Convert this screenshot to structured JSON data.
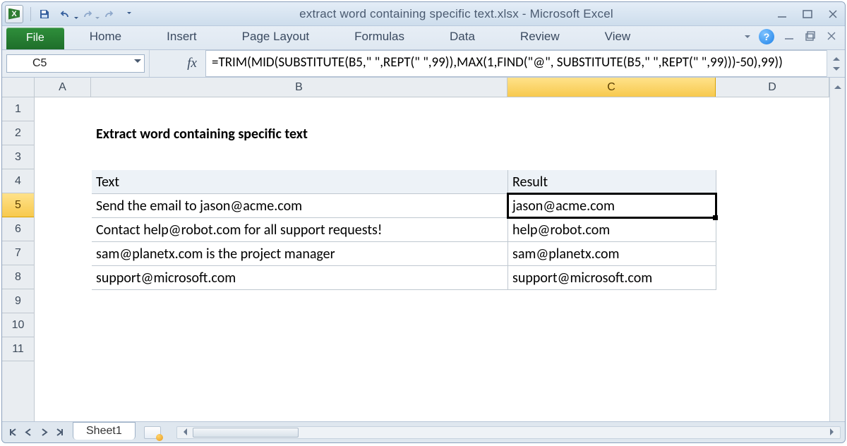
{
  "window": {
    "title": "extract word containing specific text.xlsx  -  Microsoft Excel"
  },
  "ribbon": {
    "file": "File",
    "tabs": [
      "Home",
      "Insert",
      "Page Layout",
      "Formulas",
      "Data",
      "Review",
      "View"
    ]
  },
  "namebox": "C5",
  "fx": "fx",
  "formula": "=TRIM(MID(SUBSTITUTE(B5,\" \",REPT(\" \",99)),MAX(1,FIND(\"@\", SUBSTITUTE(B5,\" \",REPT(\" \",99)))-50),99))",
  "columns": [
    "A",
    "B",
    "C",
    "D"
  ],
  "rows": [
    "1",
    "2",
    "3",
    "4",
    "5",
    "6",
    "7",
    "8",
    "9",
    "10",
    "11"
  ],
  "selected_row": "5",
  "selected_col": "C",
  "sheet": {
    "title": "Extract word containing specific text",
    "headers": {
      "text": "Text",
      "result": "Result"
    },
    "data": [
      {
        "text": "Send the email to jason@acme.com",
        "result": "jason@acme.com"
      },
      {
        "text": "Contact help@robot.com for all support requests!",
        "result": "help@robot.com"
      },
      {
        "text": "sam@planetx.com is the project manager",
        "result": "sam@planetx.com"
      },
      {
        "text": "support@microsoft.com",
        "result": "support@microsoft.com"
      }
    ]
  },
  "tabs": {
    "sheet1": "Sheet1"
  }
}
